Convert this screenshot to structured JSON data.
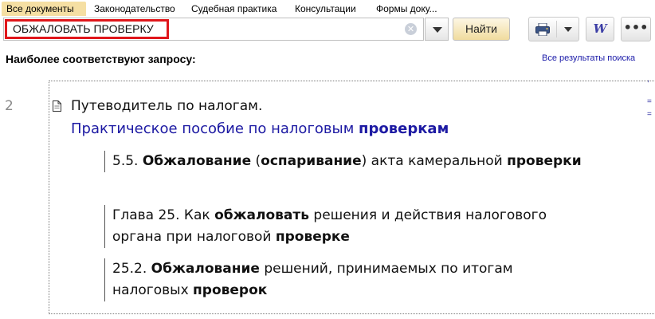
{
  "tabs": [
    {
      "label": "Все документы",
      "active": true
    },
    {
      "label": "Законодательство",
      "active": false
    },
    {
      "label": "Судебная практика",
      "active": false
    },
    {
      "label": "Консультации",
      "active": false
    },
    {
      "label": "Формы доку...",
      "active": false
    }
  ],
  "search": {
    "value": "ОБЖАЛОВАТЬ ПРОВЕРКУ",
    "find_label": "Найти"
  },
  "toolbar": {
    "print_icon": "printer-icon",
    "word_icon": "word-export-icon",
    "word_label": "W",
    "more_icon": "more-icon",
    "more_label": "•••"
  },
  "results": {
    "heading": "Наиболее соответствуют запросу:",
    "all_results_link": "Все результаты поиска"
  },
  "result": {
    "number": "2",
    "title": "Путеводитель по налогам.",
    "subtitle_parts": [
      {
        "text": "Практическое пособие по налоговым ",
        "bold": false
      },
      {
        "text": "проверкам",
        "bold": true
      }
    ],
    "fragments": [
      [
        {
          "text": "5.5. ",
          "bold": false
        },
        {
          "text": "Обжалование",
          "bold": true
        },
        {
          "text": " (",
          "bold": false
        },
        {
          "text": "оспаривание",
          "bold": true
        },
        {
          "text": ") акта камеральной ",
          "bold": false
        },
        {
          "text": "проверки",
          "bold": true
        }
      ],
      [
        {
          "text": "Глава 25. Как ",
          "bold": false
        },
        {
          "text": "обжаловать",
          "bold": true
        },
        {
          "text": " решения и действия налогового органа при налоговой ",
          "bold": false
        },
        {
          "text": "проверке",
          "bold": true
        }
      ],
      [
        {
          "text": "25.2. ",
          "bold": false
        },
        {
          "text": "Обжалование",
          "bold": true
        },
        {
          "text": " решений, принимаемых по итогам налоговых ",
          "bold": false
        },
        {
          "text": "проверок",
          "bold": true
        }
      ]
    ]
  },
  "colors": {
    "active_tab": "#f5dfa3",
    "search_highlight": "#e0161b",
    "link": "#1d1aa3"
  }
}
